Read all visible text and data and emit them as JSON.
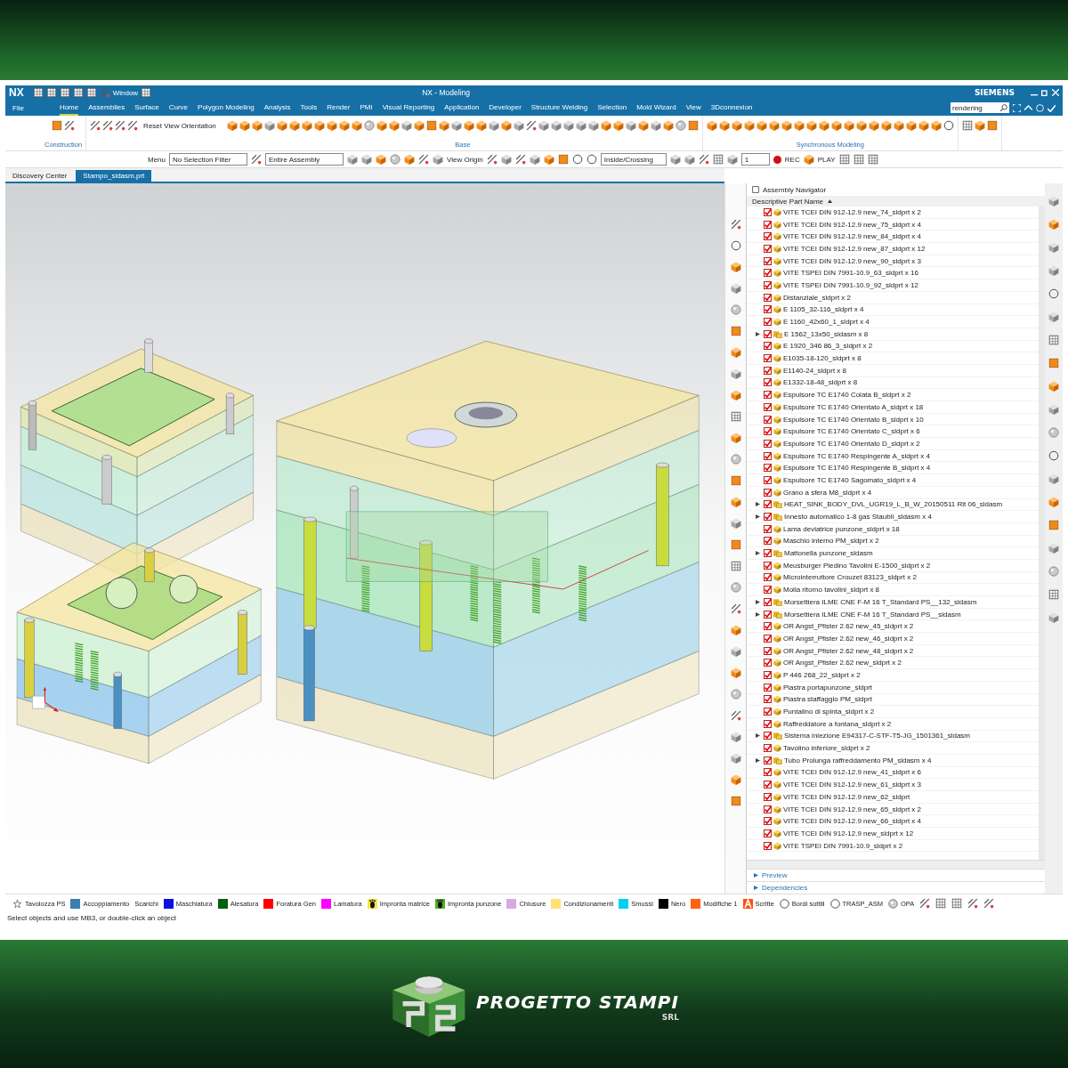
{
  "banner": {
    "logo_text": "PROGETTO STAMPI",
    "logo_subtext": "SRL"
  },
  "window": {
    "app": "NX",
    "title": "NX - Modeling",
    "brand": "SIEMENS",
    "window_menu": "Window"
  },
  "file_menu": "File",
  "tabs": [
    {
      "label": "Home",
      "selected": true
    },
    {
      "label": "Assemblies",
      "selected": false
    },
    {
      "label": "Surface",
      "selected": false
    },
    {
      "label": "Curve",
      "selected": false
    },
    {
      "label": "Polygon Modeling",
      "selected": false
    },
    {
      "label": "Analysis",
      "selected": false
    },
    {
      "label": "Tools",
      "selected": false
    },
    {
      "label": "Render",
      "selected": false
    },
    {
      "label": "PMI",
      "selected": false
    },
    {
      "label": "Visual Reporting",
      "selected": false
    },
    {
      "label": "Application",
      "selected": false
    },
    {
      "label": "Developer",
      "selected": false
    },
    {
      "label": "Structure Welding",
      "selected": false
    },
    {
      "label": "Selection",
      "selected": false
    },
    {
      "label": "Mold Wizard",
      "selected": false
    },
    {
      "label": "View",
      "selected": false
    },
    {
      "label": "3Dconnexion",
      "selected": false
    }
  ],
  "search": {
    "value": "rendering"
  },
  "ribbon": {
    "construction_label": "Construction",
    "view_button": "Reset View Orientation",
    "base_label": "Base",
    "sync_label": "Synchronous Modeling"
  },
  "selection_bar": {
    "menu": "Menu",
    "filter": "No Selection Filter",
    "scope": "Entire Assembly",
    "view_origin": "View Origin",
    "selection_mode": "Inside/Crossing",
    "count": "1",
    "rec": "REC",
    "play": "PLAY"
  },
  "doc_tabs": [
    {
      "label": "Discovery Center",
      "selected": false
    },
    {
      "label": "Stampo_sldasm.prt",
      "selected": true
    }
  ],
  "navigator": {
    "title": "Assembly Navigator",
    "column": "Descriptive Part Name",
    "items": [
      {
        "label": "VITE TCEI DIN 912-12.9 new_74_sldprt x 2",
        "kind": "part",
        "checked": true
      },
      {
        "label": "VITE TCEI DIN 912-12.9 new_75_sldprt x 4",
        "kind": "part",
        "checked": true
      },
      {
        "label": "VITE TCEI DIN 912-12.9 new_84_sldprt x 4",
        "kind": "part",
        "checked": true
      },
      {
        "label": "VITE TCEI DIN 912-12.9 new_87_sldprt x 12",
        "kind": "part",
        "checked": true
      },
      {
        "label": "VITE TCEI DIN 912-12.9 new_90_sldprt x 3",
        "kind": "part",
        "checked": true
      },
      {
        "label": "VITE TSPEI DIN 7991-10.9_63_sldprt x 16",
        "kind": "part",
        "checked": true
      },
      {
        "label": "VITE TSPEI DIN 7991-10.9_92_sldprt x 12",
        "kind": "part",
        "checked": true
      },
      {
        "label": "Distanziale_sldprt x 2",
        "kind": "part",
        "checked": true
      },
      {
        "label": "E 1105_32-116_sldprt x 4",
        "kind": "part",
        "checked": true
      },
      {
        "label": "E 1160_42x60_1_sldprt x 4",
        "kind": "part",
        "checked": true
      },
      {
        "label": "E 1562_13x50_sldasm x 8",
        "kind": "assembly",
        "checked": true
      },
      {
        "label": "E 1920_346 86_3_sldprt x 2",
        "kind": "part",
        "checked": true
      },
      {
        "label": "E1035-18-120_sldprt x 8",
        "kind": "part",
        "checked": true
      },
      {
        "label": "E1140-24_sldprt x 8",
        "kind": "part",
        "checked": true
      },
      {
        "label": "E1332-18-48_sldprt x 8",
        "kind": "part",
        "checked": true
      },
      {
        "label": "Espulsore TC E1740 Colata B_sldprt x 2",
        "kind": "part",
        "checked": true
      },
      {
        "label": "Espulsore TC E1740 Orientato A_sldprt x 18",
        "kind": "part",
        "checked": true
      },
      {
        "label": "Espulsore TC E1740 Orientato B_sldprt x 10",
        "kind": "part",
        "checked": true
      },
      {
        "label": "Espulsore TC E1740 Orientato C_sldprt x 6",
        "kind": "part",
        "checked": true
      },
      {
        "label": "Espulsore TC E1740 Orientato D_sldprt x 2",
        "kind": "part",
        "checked": true
      },
      {
        "label": "Espulsore TC E1740 Respingente A_sldprt x 4",
        "kind": "part",
        "checked": true
      },
      {
        "label": "Espulsore TC E1740 Respingente B_sldprt x 4",
        "kind": "part",
        "checked": true
      },
      {
        "label": "Espulsore TC E1740 Sagomato_sldprt x 4",
        "kind": "part",
        "checked": true
      },
      {
        "label": "Grano a sfera M8_sldprt x 4",
        "kind": "part",
        "checked": true
      },
      {
        "label": "HEAT_SINK_BODY_DVL_UGR19_L_B_W_20150511 Rit 06_sldasm",
        "kind": "assembly",
        "checked": true
      },
      {
        "label": "Innesto automatico 1-8 gas Staubli_sldasm x 4",
        "kind": "assembly",
        "checked": true
      },
      {
        "label": "Lama deviatrice punzone_sldprt x 18",
        "kind": "part",
        "checked": true
      },
      {
        "label": "Maschio interno PM_sldprt x 2",
        "kind": "part",
        "checked": true
      },
      {
        "label": "Mattonella punzone_sldasm",
        "kind": "assembly",
        "checked": true
      },
      {
        "label": "Meusburger Piedino Tavolini E-1500_sldprt x 2",
        "kind": "part",
        "checked": true
      },
      {
        "label": "Microinterruttore Crouzet 83123_sldprt x 2",
        "kind": "part",
        "checked": true
      },
      {
        "label": "Molla ritorno tavolini_sldprt x 8",
        "kind": "part",
        "checked": true
      },
      {
        "label": "Morsettiera ILME CNE F-M 16 T_Standard PS__132_sldasm",
        "kind": "assembly",
        "checked": true
      },
      {
        "label": "Morsettiera ILME CNE F-M 16 T_Standard PS__sldasm",
        "kind": "assembly",
        "checked": true
      },
      {
        "label": "OR Angst_Pfister 2.62 new_45_sldprt x 2",
        "kind": "part",
        "checked": true
      },
      {
        "label": "OR Angst_Pfister 2.62 new_46_sldprt x 2",
        "kind": "part",
        "checked": true
      },
      {
        "label": "OR Angst_Pfister 2.62 new_48_sldprt x 2",
        "kind": "part",
        "checked": true
      },
      {
        "label": "OR Angst_Pfister 2.62 new_sldprt x 2",
        "kind": "part",
        "checked": true
      },
      {
        "label": "P 446 268_22_sldprt x 2",
        "kind": "part",
        "checked": true
      },
      {
        "label": "Piastra portapunzone_sldprt",
        "kind": "part",
        "checked": true
      },
      {
        "label": "Piastra staffaggio PM_sldprt",
        "kind": "part",
        "checked": true
      },
      {
        "label": "Puntalino di spinta_sldprt x 2",
        "kind": "part",
        "checked": true
      },
      {
        "label": "Raffreddatore a fontana_sldprt x 2",
        "kind": "part",
        "checked": true
      },
      {
        "label": "Sistema iniezione E94317-C-STF-T5-JG_1501361_sldasm",
        "kind": "assembly",
        "checked": true
      },
      {
        "label": "Tavolino inferiore_sldprt x 2",
        "kind": "part",
        "checked": true
      },
      {
        "label": "Tubo Prolunga raffreddamento PM_sldasm x 4",
        "kind": "assembly",
        "checked": true
      },
      {
        "label": "VITE TCEI DIN 912-12.9 new_41_sldprt x 6",
        "kind": "part",
        "checked": true
      },
      {
        "label": "VITE TCEI DIN 912-12.9 new_61_sldprt x 3",
        "kind": "part",
        "checked": true
      },
      {
        "label": "VITE TCEI DIN 912-12.9 new_62_sldprt",
        "kind": "part",
        "checked": true
      },
      {
        "label": "VITE TCEI DIN 912-12.9 new_65_sldprt x 2",
        "kind": "part",
        "checked": true
      },
      {
        "label": "VITE TCEI DIN 912-12.9 new_66_sldprt x 4",
        "kind": "part",
        "checked": true
      },
      {
        "label": "VITE TCEI DIN 912-12.9 new_sldprt x 12",
        "kind": "part",
        "checked": true
      },
      {
        "label": "VITE TSPEI DIN 7991-10.9_sldprt x 2",
        "kind": "part",
        "checked": true
      }
    ],
    "sections": [
      "Preview",
      "Dependencies"
    ]
  },
  "legend": [
    {
      "label": "Tavolozza PS",
      "kind": "palette"
    },
    {
      "label": "Accoppiamento",
      "kind": "swatch",
      "color": "#3a7fb0"
    },
    {
      "label": "Scarichi",
      "kind": "plain"
    },
    {
      "label": "Maschiatura",
      "kind": "swatch",
      "color": "#1010e0"
    },
    {
      "label": "Alesatura",
      "kind": "swatch",
      "color": "#006010"
    },
    {
      "label": "Foratura Gen",
      "kind": "swatch",
      "color": "#ff0000"
    },
    {
      "label": "Lamatura",
      "kind": "swatch",
      "color": "#ff00ff"
    },
    {
      "label": "Impronta matrice",
      "kind": "footprint",
      "color": "#f8e840"
    },
    {
      "label": "Impronta punzone",
      "kind": "footprint",
      "color": "#50b020"
    },
    {
      "label": "Chiusure",
      "kind": "swatch",
      "color": "#d8a8e0"
    },
    {
      "label": "Condizionamenti",
      "kind": "swatch",
      "color": "#ffe070"
    },
    {
      "label": "Smussi",
      "kind": "swatch",
      "color": "#00d0f0"
    },
    {
      "label": "Nero",
      "kind": "swatch",
      "color": "#000000"
    },
    {
      "label": "Modifiche 1",
      "kind": "swatch",
      "color": "#ff6010"
    },
    {
      "label": "Scritte",
      "kind": "letter"
    },
    {
      "label": "Bordi sottili",
      "kind": "ring"
    },
    {
      "label": "TRASP_ASM",
      "kind": "ring"
    },
    {
      "label": "OPA",
      "kind": "sphere"
    }
  ],
  "status_bar": "Select objects and use MB3, or double-click an object"
}
